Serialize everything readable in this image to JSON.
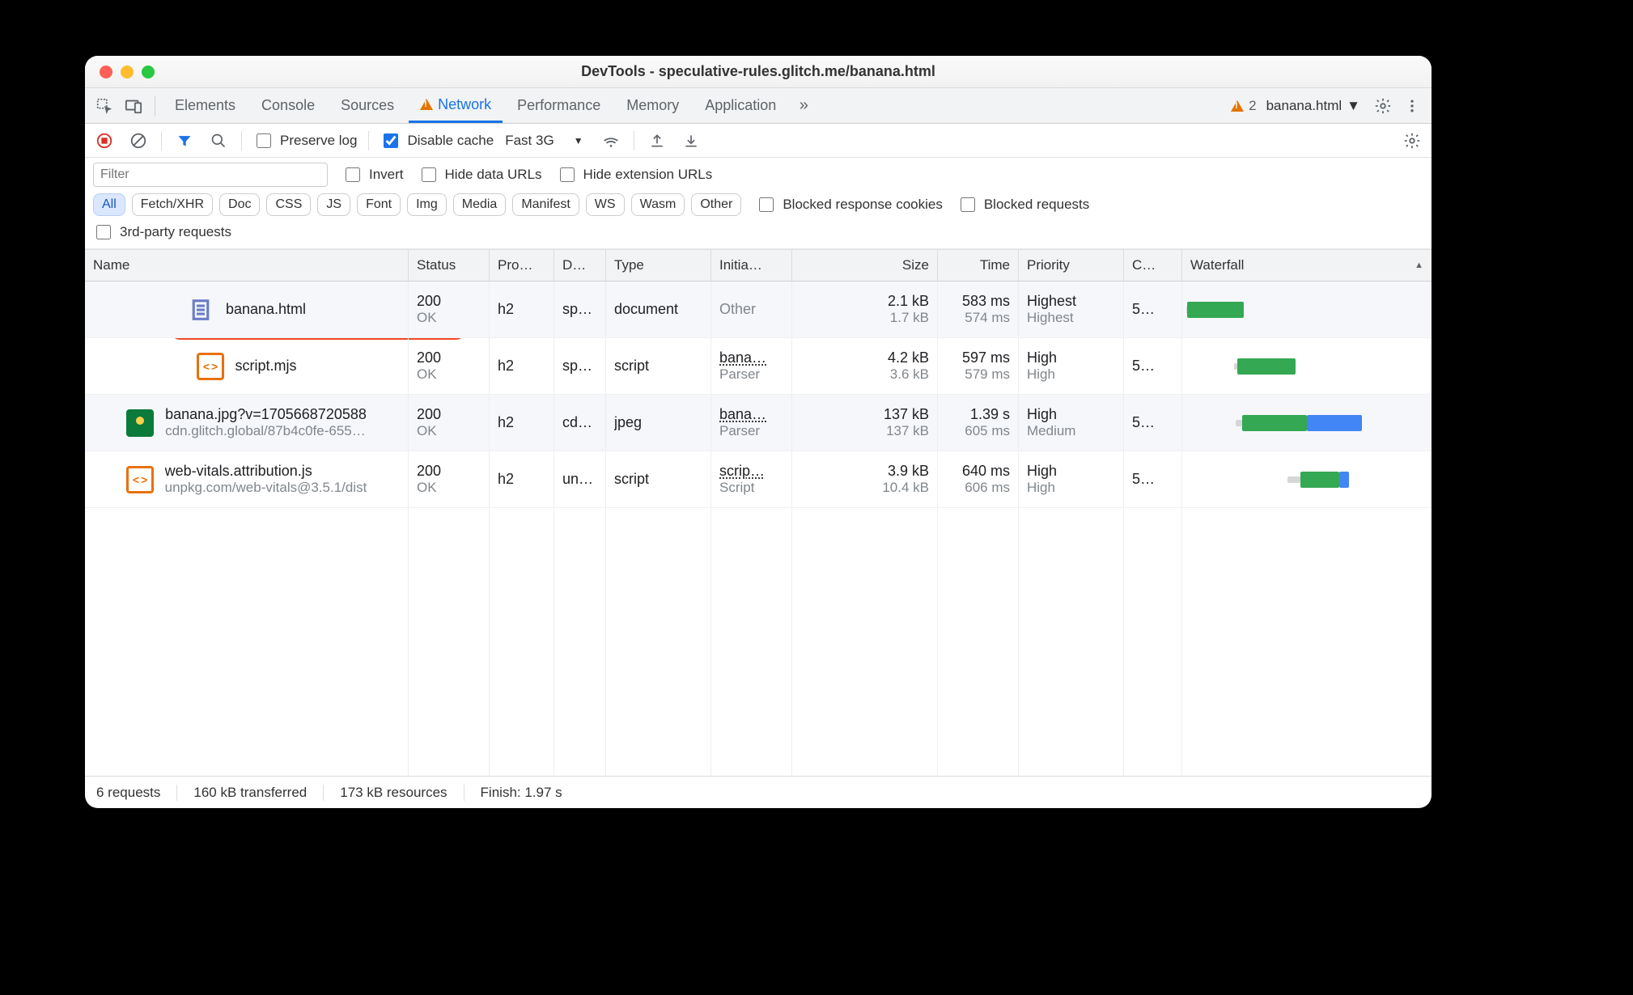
{
  "window": {
    "title": "DevTools - speculative-rules.glitch.me/banana.html"
  },
  "tabs": {
    "items": [
      "Elements",
      "Console",
      "Sources",
      "Network",
      "Performance",
      "Memory",
      "Application"
    ],
    "overflow": "»",
    "active_index": 3,
    "warning_count": "2",
    "context_label": "banana.html"
  },
  "toolbar": {
    "preserve_log": "Preserve log",
    "disable_cache": "Disable cache",
    "throttling": "Fast 3G"
  },
  "filterbar": {
    "filter_placeholder": "Filter",
    "invert": "Invert",
    "hide_data_urls": "Hide data URLs",
    "hide_ext_urls": "Hide extension URLs",
    "types": [
      "All",
      "Fetch/XHR",
      "Doc",
      "CSS",
      "JS",
      "Font",
      "Img",
      "Media",
      "Manifest",
      "WS",
      "Wasm",
      "Other"
    ],
    "blocked_cookies": "Blocked response cookies",
    "blocked_requests": "Blocked requests",
    "third_party": "3rd-party requests"
  },
  "columns": [
    "Name",
    "Status",
    "Pro…",
    "D…",
    "Type",
    "Initia…",
    "Size",
    "Time",
    "Priority",
    "C…",
    "Waterfall"
  ],
  "rows": [
    {
      "icon": "doc",
      "name": "banana.html",
      "name2": "",
      "status": "200",
      "status2": "OK",
      "proto": "h2",
      "domain": "sp…",
      "type": "document",
      "initiator": "Other",
      "initiator_muted": true,
      "initiator2": "",
      "size": "2.1 kB",
      "size2": "1.7 kB",
      "time": "583 ms",
      "time2": "574 ms",
      "priority": "Highest",
      "priority2": "Highest",
      "conn": "5…",
      "wf": {
        "start": 1,
        "wait": 1,
        "ttfb": 70,
        "dl": 0
      }
    },
    {
      "icon": "script",
      "name": "script.mjs",
      "name2": "",
      "status": "200",
      "status2": "OK",
      "proto": "h2",
      "domain": "sp…",
      "type": "script",
      "initiator": "bana…",
      "initiator_muted": false,
      "initiator2": "Parser",
      "size": "4.2 kB",
      "size2": "3.6 kB",
      "time": "597 ms",
      "time2": "579 ms",
      "priority": "High",
      "priority2": "High",
      "conn": "5…",
      "wf": {
        "start": 60,
        "wait": 4,
        "ttfb": 72,
        "dl": 0
      }
    },
    {
      "icon": "img",
      "name": "banana.jpg?v=1705668720588",
      "name2": "cdn.glitch.global/87b4c0fe-655…",
      "status": "200",
      "status2": "OK",
      "proto": "h2",
      "domain": "cd…",
      "type": "jpeg",
      "initiator": "bana…",
      "initiator_muted": false,
      "initiator2": "Parser",
      "size": "137 kB",
      "size2": "137 kB",
      "time": "1.39 s",
      "time2": "605 ms",
      "priority": "High",
      "priority2": "Medium",
      "conn": "5…",
      "wf": {
        "start": 62,
        "wait": 8,
        "ttfb": 80,
        "dl": 68
      }
    },
    {
      "icon": "script",
      "name": "web-vitals.attribution.js",
      "name2": "unpkg.com/web-vitals@3.5.1/dist",
      "status": "200",
      "status2": "OK",
      "proto": "h2",
      "domain": "un…",
      "type": "script",
      "initiator": "scrip…",
      "initiator_muted": false,
      "initiator2": "Script",
      "size": "3.9 kB",
      "size2": "10.4 kB",
      "time": "640 ms",
      "time2": "606 ms",
      "priority": "High",
      "priority2": "High",
      "conn": "5…",
      "wf": {
        "start": 126,
        "wait": 16,
        "ttfb": 48,
        "dl": 12
      }
    }
  ],
  "status": {
    "requests": "6 requests",
    "transferred": "160 kB transferred",
    "resources": "173 kB resources",
    "finish": "Finish: 1.97 s"
  }
}
